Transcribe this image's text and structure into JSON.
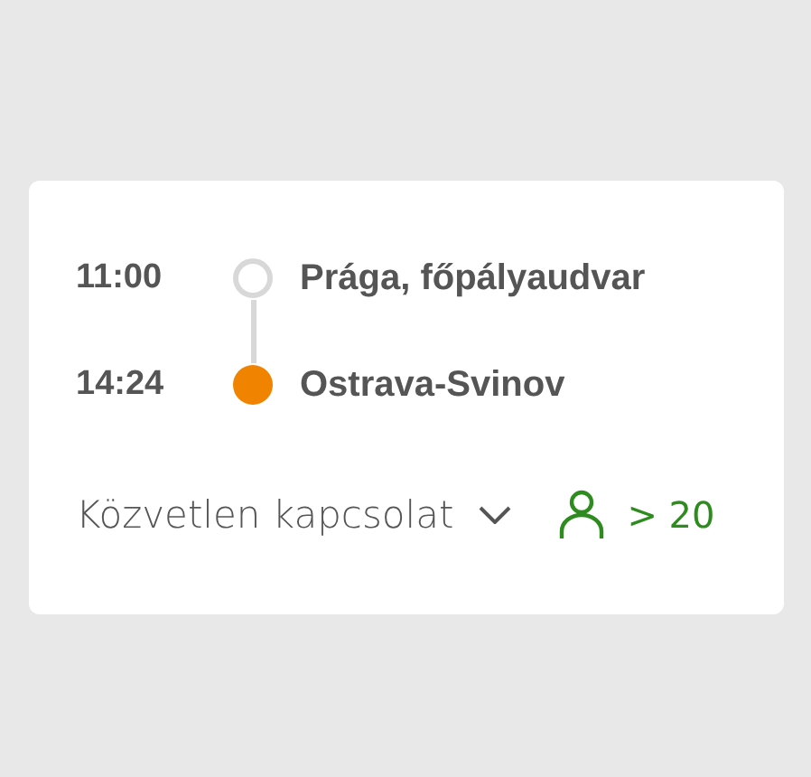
{
  "stops": [
    {
      "time": "11:00",
      "station": "Prága, főpályaudvar",
      "kind": "origin"
    },
    {
      "time": "14:24",
      "station": "Ostrava-Svinov",
      "kind": "destination"
    }
  ],
  "connection": {
    "label": "Közvetlen kapcsolat",
    "expanded": false
  },
  "seats": {
    "label": "> 20"
  }
}
